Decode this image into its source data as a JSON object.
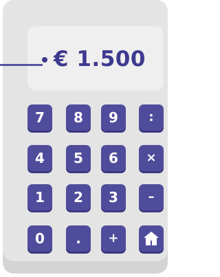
{
  "display": {
    "value": "€ 1.500"
  },
  "keypad": {
    "rows": [
      [
        "7",
        "8",
        "9",
        ":"
      ],
      [
        "4",
        "5",
        "6",
        "×"
      ],
      [
        "1",
        "2",
        "3",
        "–"
      ],
      [
        "0",
        ".",
        "+",
        ""
      ]
    ]
  },
  "colors": {
    "accent": "#504c9c",
    "display_text": "#3d3a8f",
    "body": "#e4e4e4",
    "screen": "#efefef"
  },
  "icons": {
    "home_key": "house-icon"
  }
}
